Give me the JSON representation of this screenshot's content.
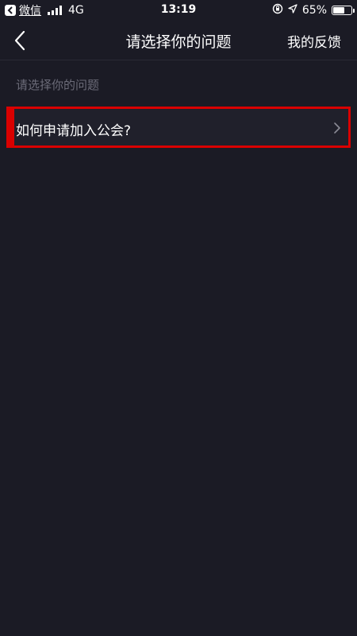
{
  "status_bar": {
    "back_app_label": "微信",
    "network": "4G",
    "time": "13:19",
    "battery_percent": "65%",
    "battery_level": 0.65,
    "icons": [
      "back-arrow-icon",
      "signal-icon",
      "rotation-lock-icon",
      "location-icon",
      "battery-icon"
    ]
  },
  "nav": {
    "title": "请选择你的问题",
    "action_label": "我的反馈",
    "back_icon": "chevron-left-icon"
  },
  "main": {
    "section_label": "请选择你的问题",
    "questions": [
      {
        "label": "如何申请加入公会?",
        "icon": "chevron-right-icon",
        "highlight_color": "#d90000"
      }
    ]
  },
  "colors": {
    "background": "#1b1b25",
    "highlight": "#d90000",
    "muted_text": "#6b6b78"
  }
}
